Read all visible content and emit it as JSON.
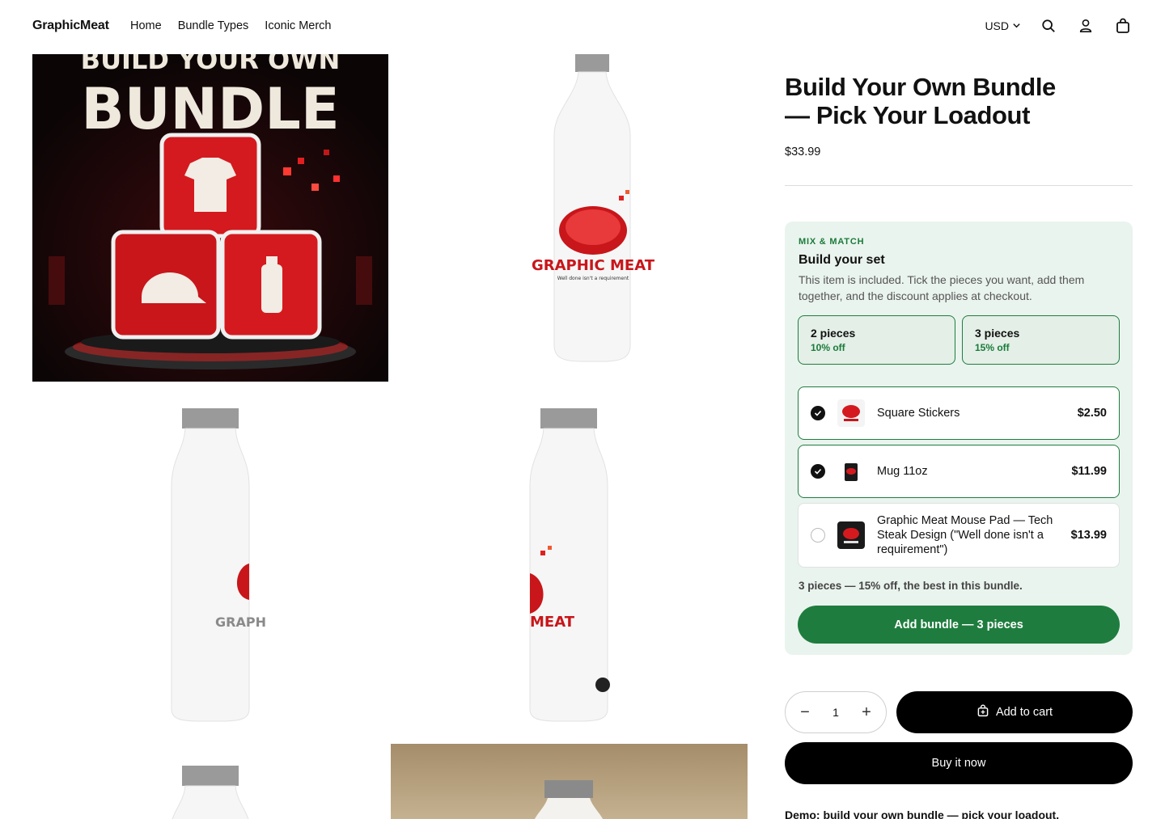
{
  "header": {
    "brand": "GraphicMeat",
    "nav": [
      "Home",
      "Bundle Types",
      "Iconic Merch"
    ],
    "currency": "USD",
    "icons": [
      "search-icon",
      "account-icon",
      "cart-icon"
    ]
  },
  "gallery": {
    "hero_text_top": "BUILD YOUR OWN",
    "hero_text_main": "BUNDLE",
    "bottle_logo": "GRAPHIC MEAT",
    "bottle_tagline": "Well done isn't a requirement",
    "bottle_partial_left": "GRAPH",
    "bottle_partial_right": "MEAT"
  },
  "product": {
    "title": "Build Your Own Bundle — Pick Your Loadout",
    "price": "$33.99"
  },
  "mix": {
    "eyebrow": "MIX & MATCH",
    "title": "Build your set",
    "description": "This item is included. Tick the pieces you want, add them together, and the discount applies at checkout.",
    "tiers": [
      {
        "name": "2 pieces",
        "discount": "10% off"
      },
      {
        "name": "3 pieces",
        "discount": "15% off"
      }
    ],
    "items": [
      {
        "name": "Square Stickers",
        "price": "$2.50",
        "selected": true
      },
      {
        "name": "Mug 11oz",
        "price": "$11.99",
        "selected": true
      },
      {
        "name": "Graphic Meat Mouse Pad — Tech Steak Design (\"Well done isn't a requirement\")",
        "price": "$13.99",
        "selected": false
      }
    ],
    "note": "3 pieces — 15% off, the best in this bundle.",
    "button": "Add bundle — 3 pieces"
  },
  "purchase": {
    "quantity": "1",
    "decrement": "−",
    "increment": "+",
    "add_to_cart": "Add to cart",
    "buy_now": "Buy it now"
  },
  "demo_text": "Demo: build your own bundle — pick your loadout.",
  "colors": {
    "accent_green": "#1e7d3e",
    "panel_bg": "#eaf4ee",
    "brand_red": "#d41a1f"
  }
}
